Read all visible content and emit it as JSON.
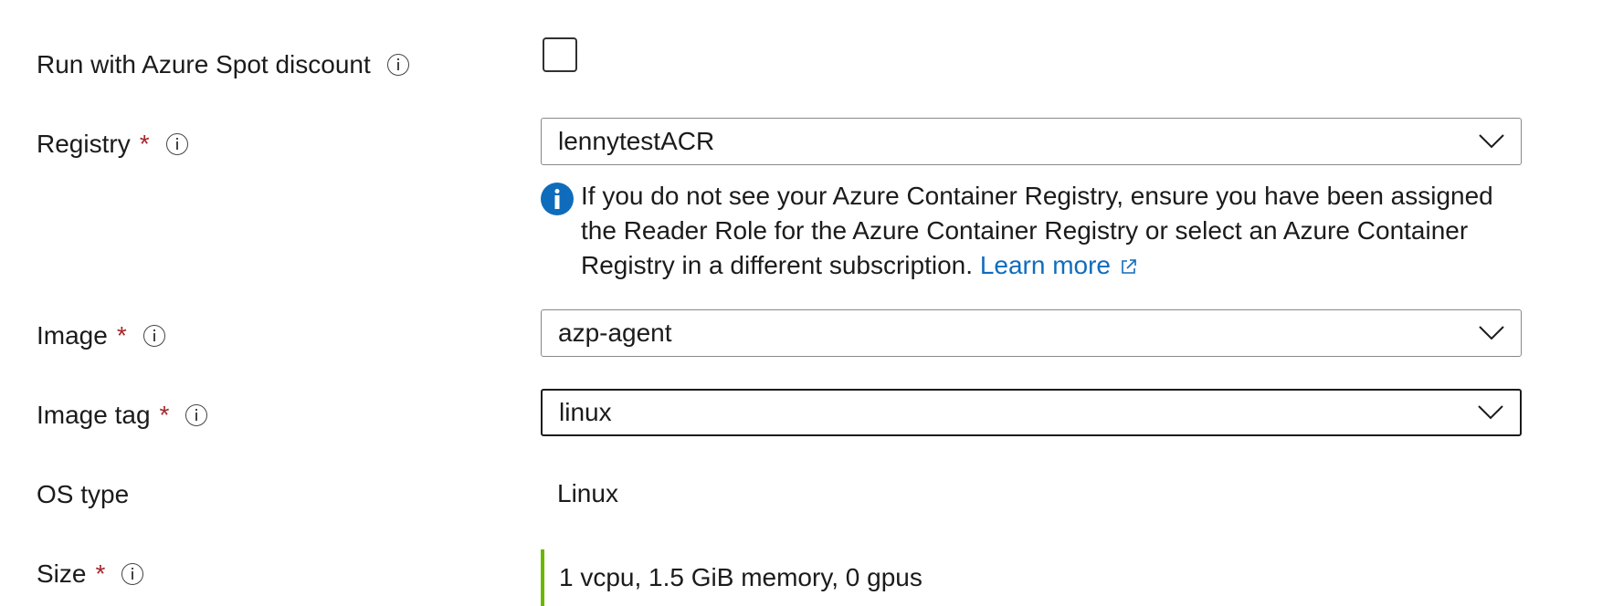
{
  "fields": {
    "spot": {
      "label": "Run with Azure Spot discount",
      "checked": false
    },
    "registry": {
      "label": "Registry",
      "required_mark": "*",
      "value": "lennytestACR",
      "notice_text": "If you do not see your Azure Container Registry, ensure you have been assigned the Reader Role for the Azure Container Registry or select an Azure Container Registry in a different subscription.",
      "learn_more": "Learn more"
    },
    "image": {
      "label": "Image",
      "required_mark": "*",
      "value": "azp-agent"
    },
    "image_tag": {
      "label": "Image tag",
      "required_mark": "*",
      "value": "linux"
    },
    "os_type": {
      "label": "OS type",
      "value": "Linux"
    },
    "size": {
      "label": "Size",
      "required_mark": "*",
      "value": "1 vcpu, 1.5 GiB memory, 0 gpus"
    }
  },
  "colors": {
    "required": "#a4262c",
    "link": "#0f6cbd",
    "info_badge": "#0f6cbd",
    "size_accent": "#6bb700"
  },
  "icons": {
    "info": "info-circle-icon",
    "chevron": "chevron-down-icon",
    "notice": "info-filled-icon",
    "external": "external-link-icon"
  }
}
